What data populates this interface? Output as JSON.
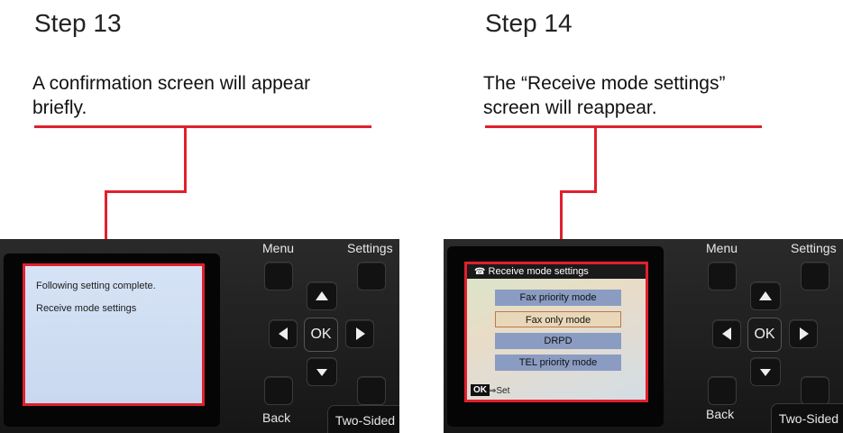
{
  "step13": {
    "title": "Step 13",
    "description_line1": "A confirmation screen will appear",
    "description_line2": "briefly.",
    "lcd": {
      "line1": "Following setting complete.",
      "line2": "Receive mode settings"
    }
  },
  "step14": {
    "title": "Step 14",
    "description_line1": "The “Receive mode settings”",
    "description_line2": "screen will reappear.",
    "lcd": {
      "title": "Receive mode settings",
      "options": [
        {
          "label": "Fax priority mode",
          "selected": false
        },
        {
          "label": "Fax only mode",
          "selected": true
        },
        {
          "label": "DRPD",
          "selected": false
        },
        {
          "label": "TEL priority mode",
          "selected": false
        }
      ],
      "ok_badge": "OK",
      "ok_hint": "⇒Set"
    }
  },
  "panel": {
    "menu_label": "Menu",
    "settings_label": "Settings",
    "back_label": "Back",
    "two_sided_label": "Two-Sided",
    "ok_label": "OK"
  },
  "colors": {
    "callout_red": "#e0202e",
    "panel_dark": "#1c1c1c"
  }
}
